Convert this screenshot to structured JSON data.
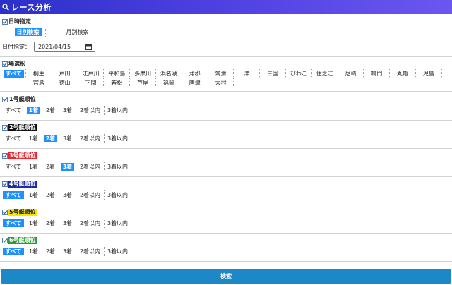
{
  "title": "レース分析",
  "date_section": {
    "title": "日時指定",
    "tabs": [
      {
        "label": "日別検索",
        "active": true
      },
      {
        "label": "月別検索",
        "active": false
      }
    ],
    "date_label": "日付指定：",
    "date_value": "2021/04/15"
  },
  "venue_section": {
    "title": "場選択",
    "row1": [
      {
        "label": "すべて",
        "active": true
      },
      {
        "label": "桐生"
      },
      {
        "label": "戸田"
      },
      {
        "label": "江戸川"
      },
      {
        "label": "平和島"
      },
      {
        "label": "多摩川"
      },
      {
        "label": "浜名湖"
      },
      {
        "label": "蒲郡"
      },
      {
        "label": "常滑"
      },
      {
        "label": "津"
      },
      {
        "label": "三国"
      },
      {
        "label": "びわこ"
      },
      {
        "label": "住之江"
      },
      {
        "label": "尼崎"
      },
      {
        "label": "鳴門"
      },
      {
        "label": "丸亀"
      },
      {
        "label": "児島"
      }
    ],
    "row2": [
      {
        "label": "宮島"
      },
      {
        "label": "徳山"
      },
      {
        "label": "下関"
      },
      {
        "label": "若松"
      },
      {
        "label": "芦屋"
      },
      {
        "label": "福岡"
      },
      {
        "label": "唐津"
      },
      {
        "label": "大村"
      }
    ]
  },
  "boat_sections": [
    {
      "title": "1号艇順位",
      "title_bg": "transparent",
      "title_fg": "#222222",
      "active_index": 1,
      "options": [
        "すべて",
        "1着",
        "2着",
        "3着",
        "2着以内",
        "3着以内"
      ]
    },
    {
      "title": "2号艇順位",
      "title_bg": "#111111",
      "title_fg": "#ffffff",
      "active_index": 2,
      "options": [
        "すべて",
        "1着",
        "2着",
        "3着",
        "2着以内",
        "3着以内"
      ]
    },
    {
      "title": "3号艇順位",
      "title_bg": "#e8262b",
      "title_fg": "#ffffff",
      "active_index": 3,
      "options": [
        "すべて",
        "1着",
        "2着",
        "3着",
        "2着以内",
        "3着以内"
      ]
    },
    {
      "title": "4号艇順位",
      "title_bg": "#1c2aa8",
      "title_fg": "#ffffff",
      "active_index": 0,
      "options": [
        "すべて",
        "1着",
        "2着",
        "3着",
        "2着以内",
        "3着以内"
      ]
    },
    {
      "title": "5号艇順位",
      "title_bg": "#f6e600",
      "title_fg": "#222222",
      "active_index": 0,
      "options": [
        "すべて",
        "1着",
        "2着",
        "3着",
        "2着以内",
        "3着以内"
      ]
    },
    {
      "title": "6号艇順位",
      "title_bg": "#2a9a3a",
      "title_fg": "#ffffff",
      "active_index": 0,
      "options": [
        "すべて",
        "1着",
        "2着",
        "3着",
        "2着以内",
        "3着以内"
      ]
    }
  ],
  "search_label": "検索",
  "icons": {
    "title": "search-icon",
    "section": "checkbox-icon",
    "date": "calendar-icon"
  },
  "colors": {
    "accent": "#1e90ff",
    "title_bar": "#3a38d8",
    "search_button": "#1e88c7"
  }
}
